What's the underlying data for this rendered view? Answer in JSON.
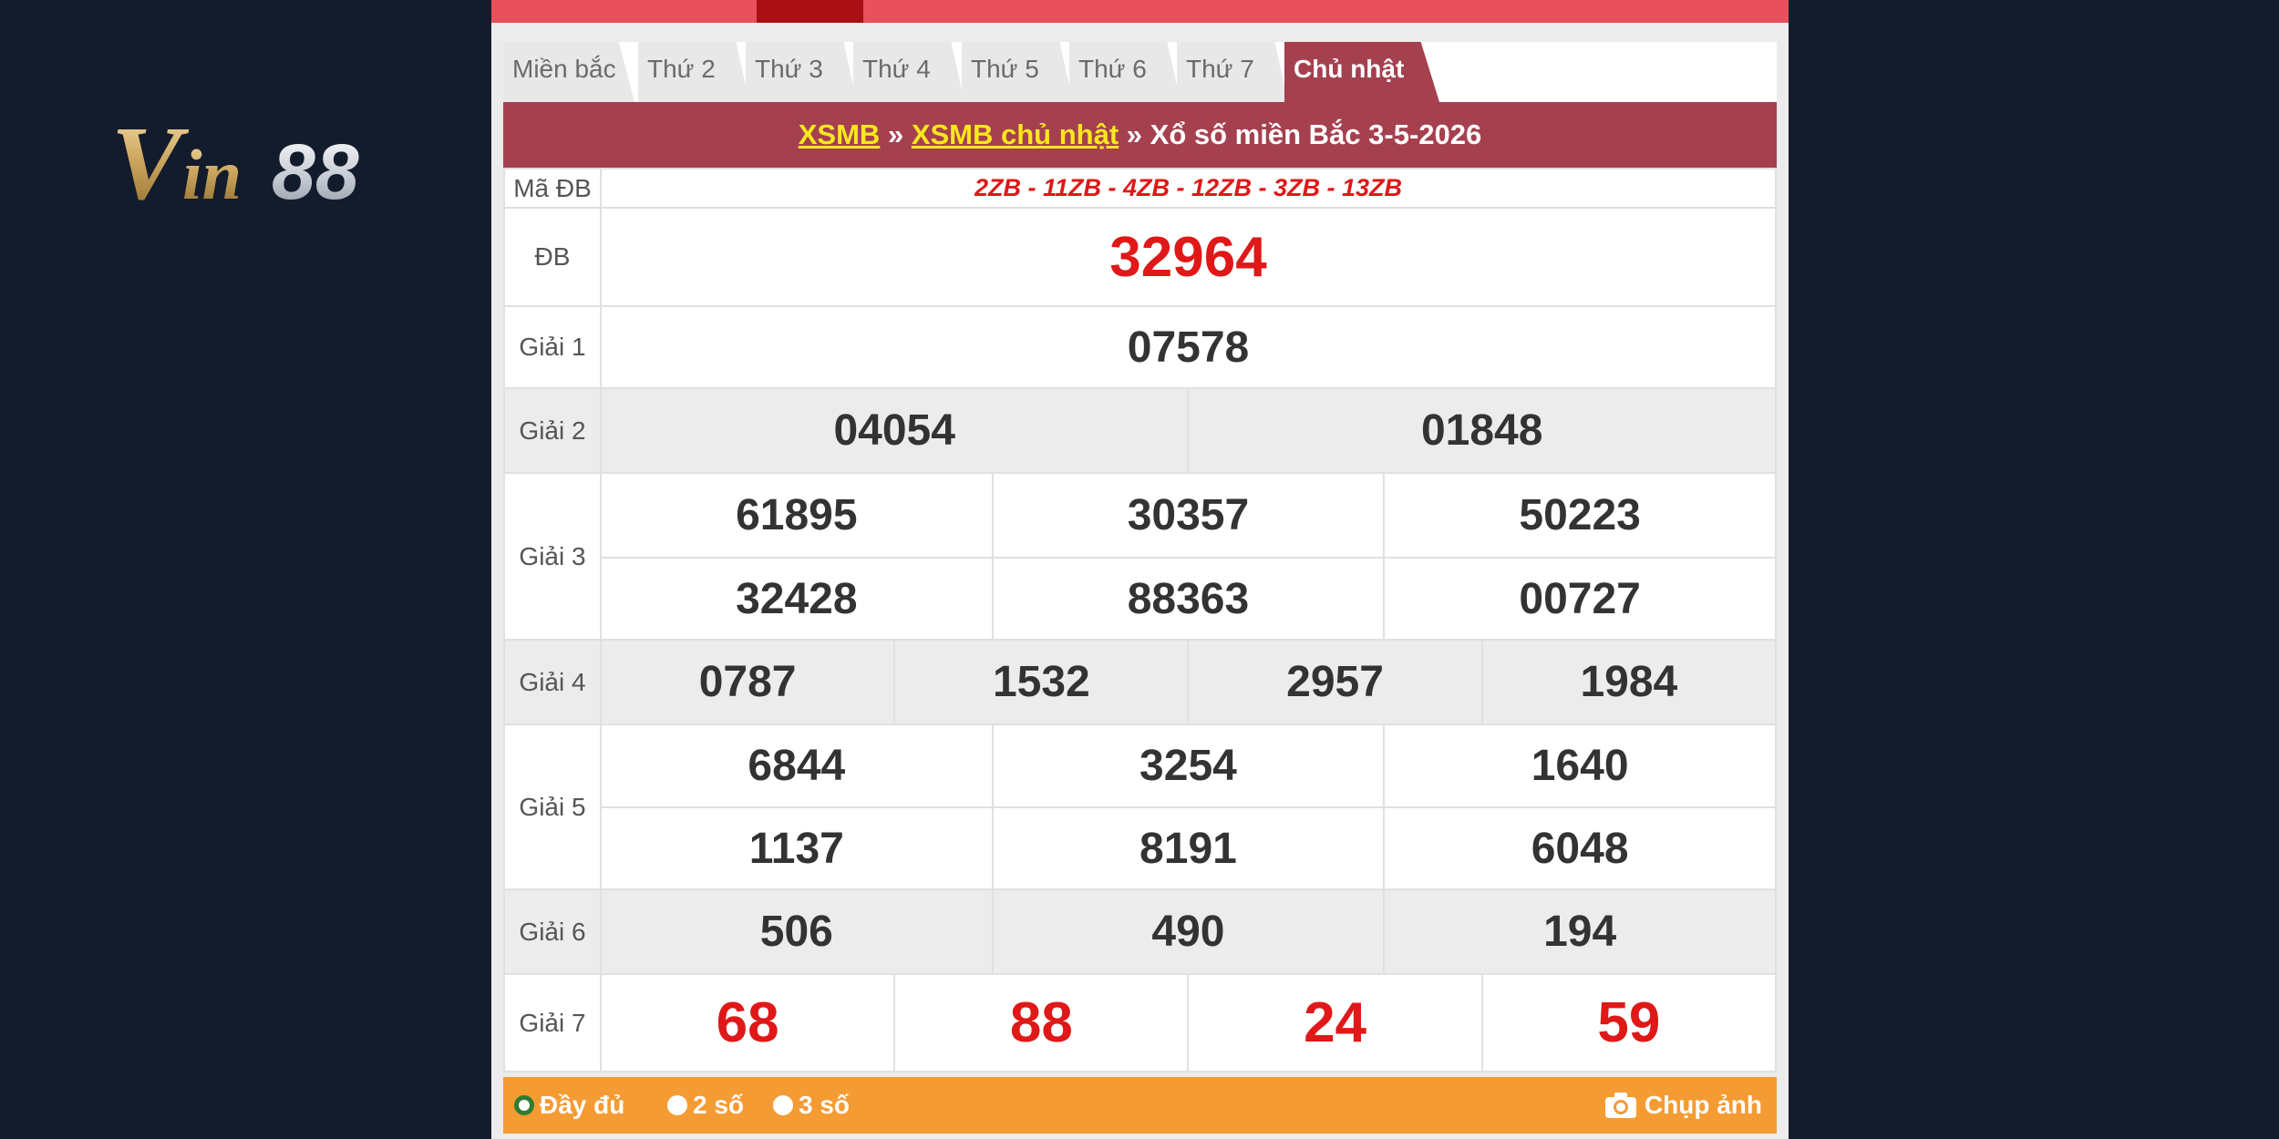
{
  "brand": {
    "logo_text": "Vin88"
  },
  "tabs": [
    {
      "label": "Miền bắc",
      "active": false
    },
    {
      "label": "Thứ 2",
      "active": false
    },
    {
      "label": "Thứ 3",
      "active": false
    },
    {
      "label": "Thứ 4",
      "active": false
    },
    {
      "label": "Thứ 5",
      "active": false
    },
    {
      "label": "Thứ 6",
      "active": false
    },
    {
      "label": "Thứ 7",
      "active": false
    },
    {
      "label": "Chủ nhật",
      "active": true
    }
  ],
  "breadcrumb": {
    "link1": "XSMB",
    "separator": "»",
    "link2": "XSMB chủ nhật",
    "current": "Xổ số miền Bắc 3-5-2026"
  },
  "results": {
    "madb": {
      "label": "Mã ĐB",
      "value": "2ZB - 11ZB - 4ZB - 12ZB - 3ZB - 13ZB"
    },
    "db": {
      "label": "ĐB",
      "numbers": [
        "32964"
      ]
    },
    "g1": {
      "label": "Giải 1",
      "numbers": [
        "07578"
      ]
    },
    "g2": {
      "label": "Giải 2",
      "numbers": [
        "04054",
        "01848"
      ]
    },
    "g3": {
      "label": "Giải 3",
      "numbers": [
        "61895",
        "30357",
        "50223",
        "32428",
        "88363",
        "00727"
      ]
    },
    "g4": {
      "label": "Giải 4",
      "numbers": [
        "0787",
        "1532",
        "2957",
        "1984"
      ]
    },
    "g5": {
      "label": "Giải 5",
      "numbers": [
        "6844",
        "3254",
        "1640",
        "1137",
        "8191",
        "6048"
      ]
    },
    "g6": {
      "label": "Giải 6",
      "numbers": [
        "506",
        "490",
        "194"
      ]
    },
    "g7": {
      "label": "Giải 7",
      "numbers": [
        "68",
        "88",
        "24",
        "59"
      ]
    }
  },
  "footer": {
    "options": [
      {
        "label": "Đầy đủ",
        "selected": true
      },
      {
        "label": "2 số",
        "selected": false
      },
      {
        "label": "3 số",
        "selected": false
      }
    ],
    "capture_label": "Chụp ảnh"
  },
  "colors": {
    "background": "#131c2c",
    "top_bar": "#e8505b",
    "header": "#a5404f",
    "accent_red": "#e01818",
    "link_yellow": "#f8e71c",
    "footer": "#f59b33"
  }
}
